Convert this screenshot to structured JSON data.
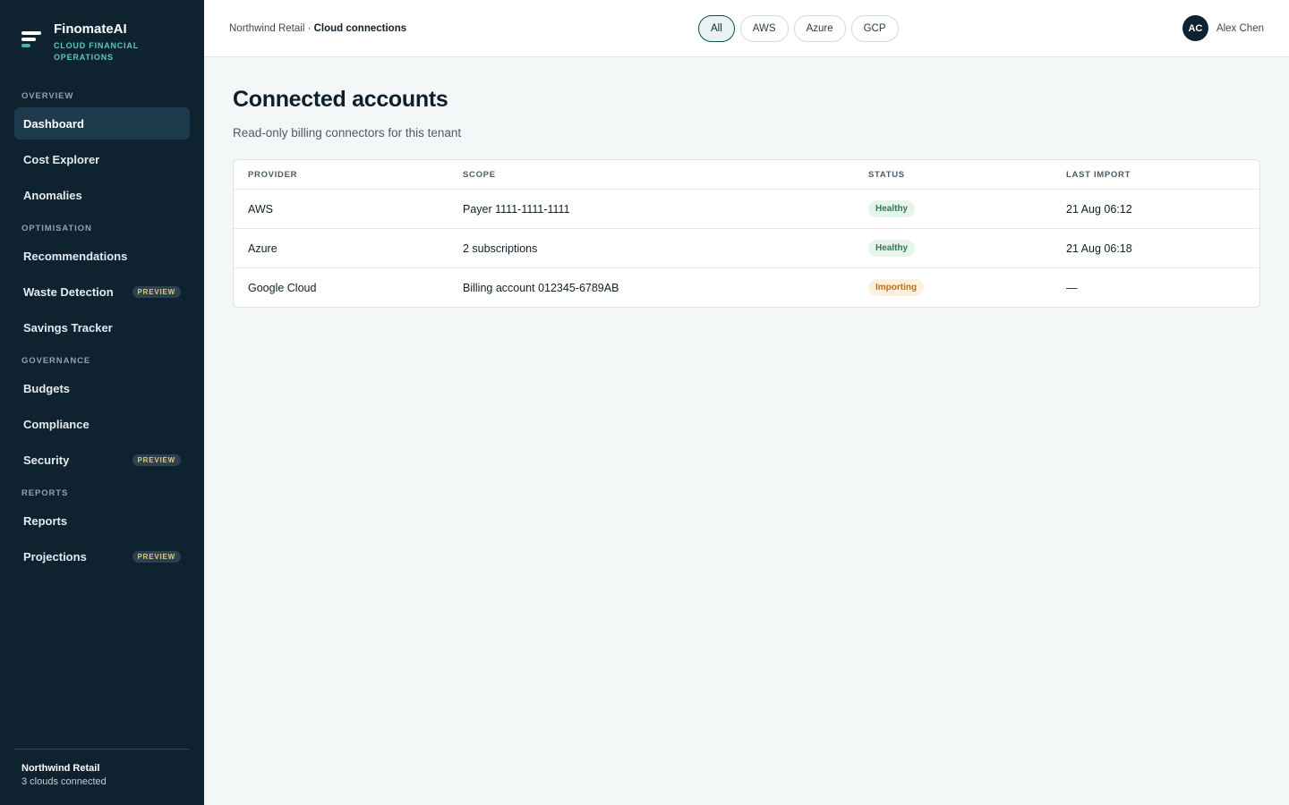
{
  "brand": {
    "name": "FinomateAI",
    "tagline": "CLOUD FINANCIAL OPERATIONS"
  },
  "sidebar": {
    "sections": [
      {
        "title": "OVERVIEW",
        "items": [
          {
            "label": "Dashboard",
            "active": true
          },
          {
            "label": "Cost Explorer"
          },
          {
            "label": "Anomalies"
          }
        ]
      },
      {
        "title": "OPTIMISATION",
        "items": [
          {
            "label": "Recommendations"
          },
          {
            "label": "Waste Detection",
            "badge": "PREVIEW"
          },
          {
            "label": "Savings Tracker"
          }
        ]
      },
      {
        "title": "GOVERNANCE",
        "items": [
          {
            "label": "Budgets"
          },
          {
            "label": "Compliance"
          },
          {
            "label": "Security",
            "badge": "PREVIEW"
          }
        ]
      },
      {
        "title": "REPORTS",
        "items": [
          {
            "label": "Reports"
          },
          {
            "label": "Projections",
            "badge": "PREVIEW"
          }
        ]
      }
    ],
    "footer": {
      "tenant": "Northwind Retail",
      "status": "3 clouds connected"
    }
  },
  "header": {
    "breadcrumb_parent": "Northwind Retail",
    "breadcrumb_separator": " · ",
    "breadcrumb_current": "Cloud connections",
    "filters": [
      {
        "label": "All",
        "active": true
      },
      {
        "label": "AWS"
      },
      {
        "label": "Azure"
      },
      {
        "label": "GCP"
      }
    ],
    "user": {
      "initials": "AC",
      "name": "Alex Chen"
    }
  },
  "main": {
    "title": "Connected accounts",
    "subtitle": "Read-only billing connectors for this tenant",
    "table": {
      "columns": [
        "PROVIDER",
        "SCOPE",
        "STATUS",
        "LAST IMPORT"
      ],
      "rows": [
        {
          "provider": "AWS",
          "scope": "Payer 1111-1111-1111",
          "status": "Healthy",
          "status_kind": "healthy",
          "last_import": "21 Aug 06:12"
        },
        {
          "provider": "Azure",
          "scope": "2 subscriptions",
          "status": "Healthy",
          "status_kind": "healthy",
          "last_import": "21 Aug 06:18"
        },
        {
          "provider": "Google Cloud",
          "scope": "Billing account 012345-6789AB",
          "status": "Importing",
          "status_kind": "importing",
          "last_import": "—"
        }
      ]
    }
  },
  "colors": {
    "sidebar_bg": "#0f2230",
    "accent": "#3fb9a0",
    "healthy": "#2e7a4c",
    "importing": "#c06c14"
  },
  "icons": {
    "brand": "finomate-logo-icon"
  }
}
